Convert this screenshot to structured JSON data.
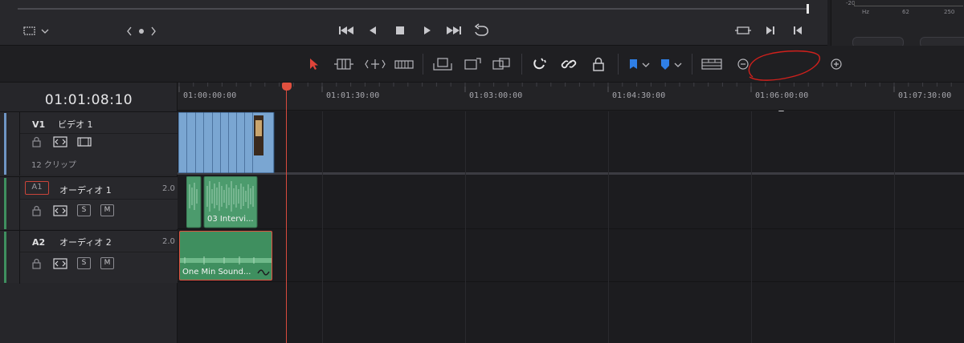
{
  "viewer": {
    "transport_icons": [
      "go-to-start-icon",
      "reverse-play-icon",
      "stop-icon",
      "play-icon",
      "go-to-end-icon",
      "loop-icon"
    ]
  },
  "eq_panel": {
    "db_label": "-20",
    "hz_labels": [
      "Hz",
      "62",
      "250"
    ]
  },
  "toolbar": {
    "colors": {
      "selection": "#e0443a",
      "flag": "#2f7fe6",
      "marker": "#2f7fe6"
    }
  },
  "ruler": {
    "ticks": [
      "01:00:00:00",
      "01:01:30:00",
      "01:03:00:00",
      "01:04:30:00",
      "01:06:00:00",
      "01:07:30:00"
    ]
  },
  "timeline": {
    "timecode": "01:01:08:10",
    "tracks": {
      "v1": {
        "code": "V1",
        "name": "ビデオ 1",
        "clip_count": "12 クリップ"
      },
      "a1": {
        "code": "A1",
        "name": "オーディオ 1",
        "channels": "2.0",
        "solo": "S",
        "mute": "M"
      },
      "a2": {
        "code": "A2",
        "name": "オーディオ 2",
        "channels": "2.0",
        "solo": "S",
        "mute": "M"
      }
    },
    "clips": {
      "a1_clip_label": "03 Intervi...",
      "a2_clip_label": "One Min Sound..."
    }
  },
  "colors": {
    "video_clip": "#7aa6d2",
    "audio_clip": "#3f8f5f",
    "selected_border": "#e0503f",
    "playhead": "#e0503f",
    "annotation": "#d0201c"
  }
}
